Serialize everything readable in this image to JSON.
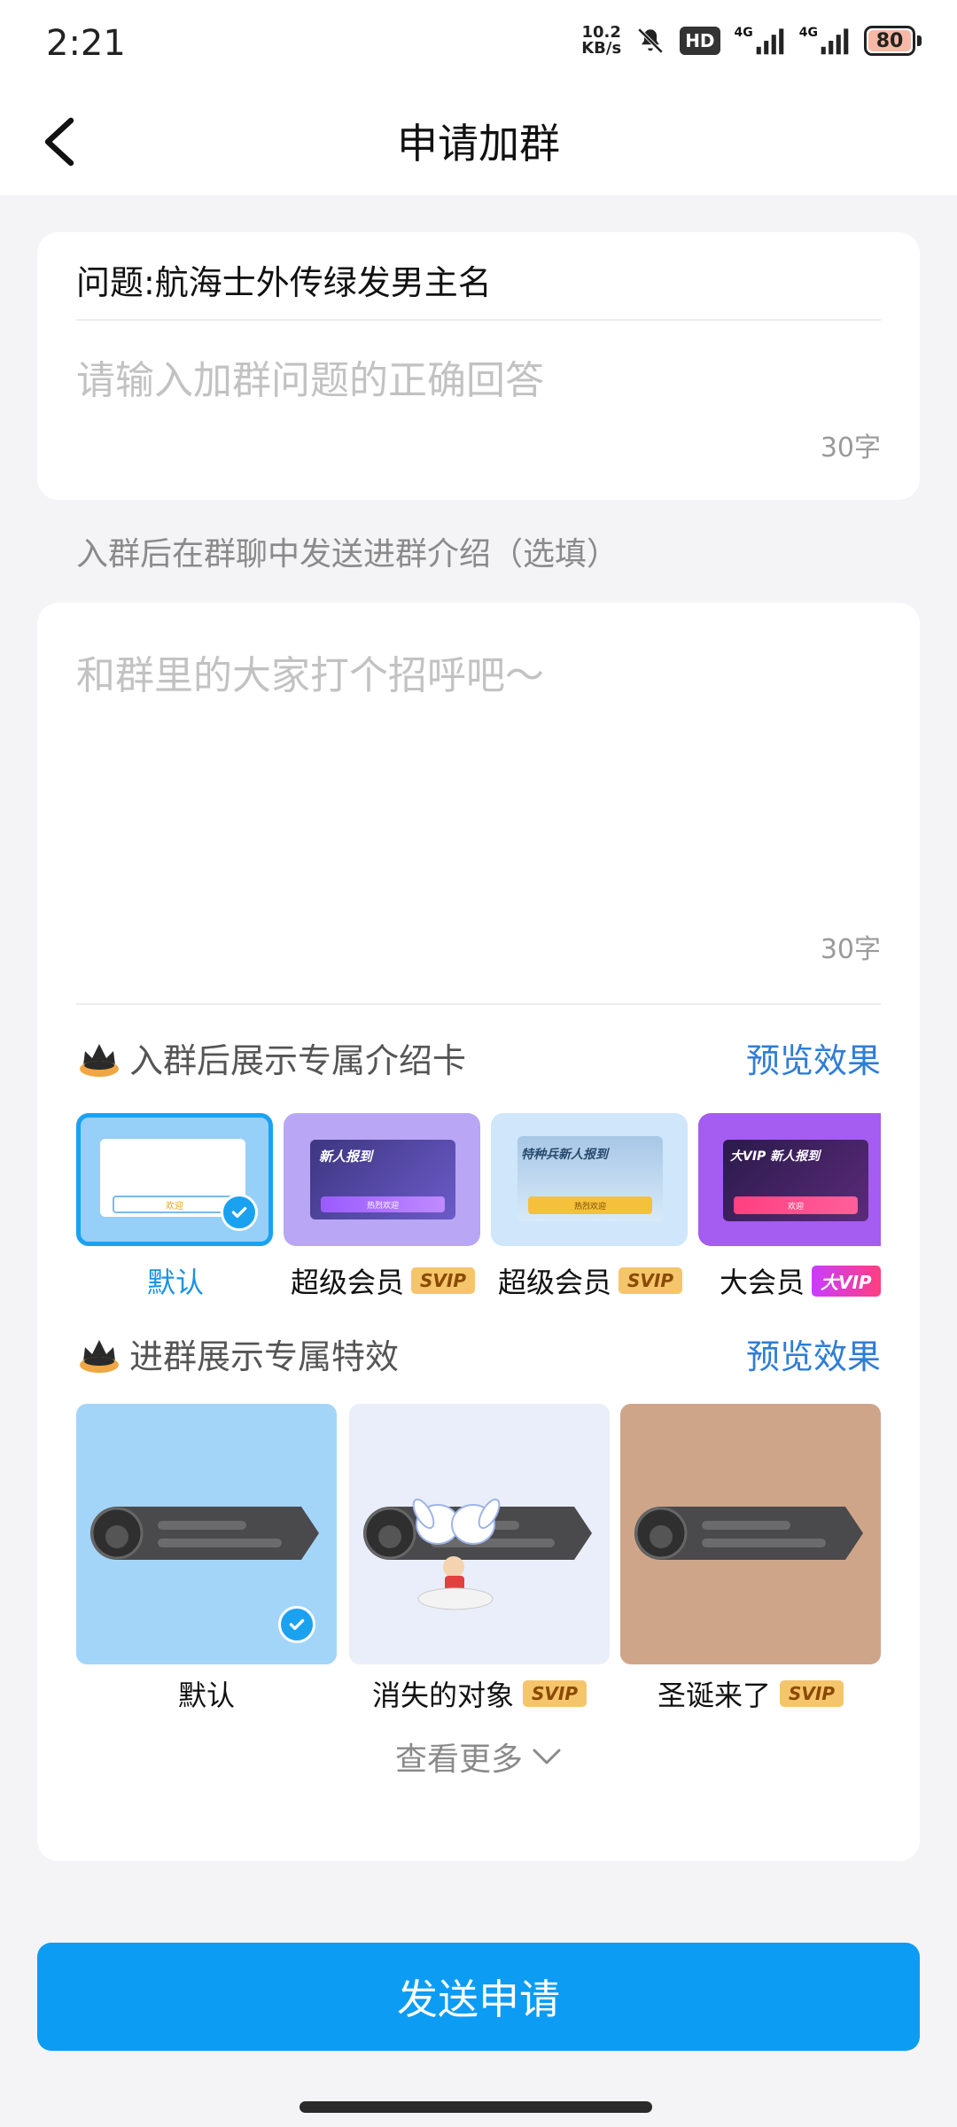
{
  "status": {
    "time": "2:21",
    "net_speed_value": "10.2",
    "net_speed_unit": "KB/s",
    "hd": "HD",
    "network1": "4G",
    "network2": "4G",
    "battery": "80"
  },
  "nav": {
    "title": "申请加群",
    "back_icon": "chevron-left-icon"
  },
  "question_card": {
    "question": "问题:航海士外传绿发男主名",
    "answer_placeholder": "请输入加群问题的正确回答",
    "count": "30字"
  },
  "intro_caption": "入群后在群聊中发送进群介绍（选填）",
  "intro_card": {
    "placeholder": "和群里的大家打个招呼吧～",
    "count": "30字",
    "card_section": {
      "title": "入群后展示专属介绍卡",
      "preview": "预览效果",
      "items": [
        {
          "label": "默认",
          "badge": "",
          "selected": true,
          "thumb_title": "",
          "thumb_button": "欢迎"
        },
        {
          "label": "超级会员",
          "badge": "SVIP",
          "selected": false,
          "thumb_title": "新人报到",
          "thumb_button": "热烈欢迎"
        },
        {
          "label": "超级会员",
          "badge": "SVIP",
          "selected": false,
          "thumb_title": "特种兵新人报到",
          "thumb_button": "热烈欢迎"
        },
        {
          "label": "大会员",
          "badge": "大VIP",
          "selected": false,
          "thumb_title": "大VIP 新人报到",
          "thumb_button": "欢迎"
        }
      ]
    },
    "effect_section": {
      "title": "进群展示专属特效",
      "preview": "预览效果",
      "items": [
        {
          "label": "默认",
          "badge": "",
          "selected": true,
          "bg": "#a3d5f8"
        },
        {
          "label": "消失的对象",
          "badge": "SVIP",
          "selected": false,
          "bg": "#eaeefa"
        },
        {
          "label": "圣诞来了",
          "badge": "SVIP",
          "selected": false,
          "bg": "#cfa58a"
        }
      ]
    },
    "see_more": "查看更多"
  },
  "send_button": "发送申请",
  "colors": {
    "accent": "#0c9cf4",
    "link": "#2f7dd6",
    "selected_border": "#1aa2f1",
    "svip_badge": "#f5c56b"
  }
}
